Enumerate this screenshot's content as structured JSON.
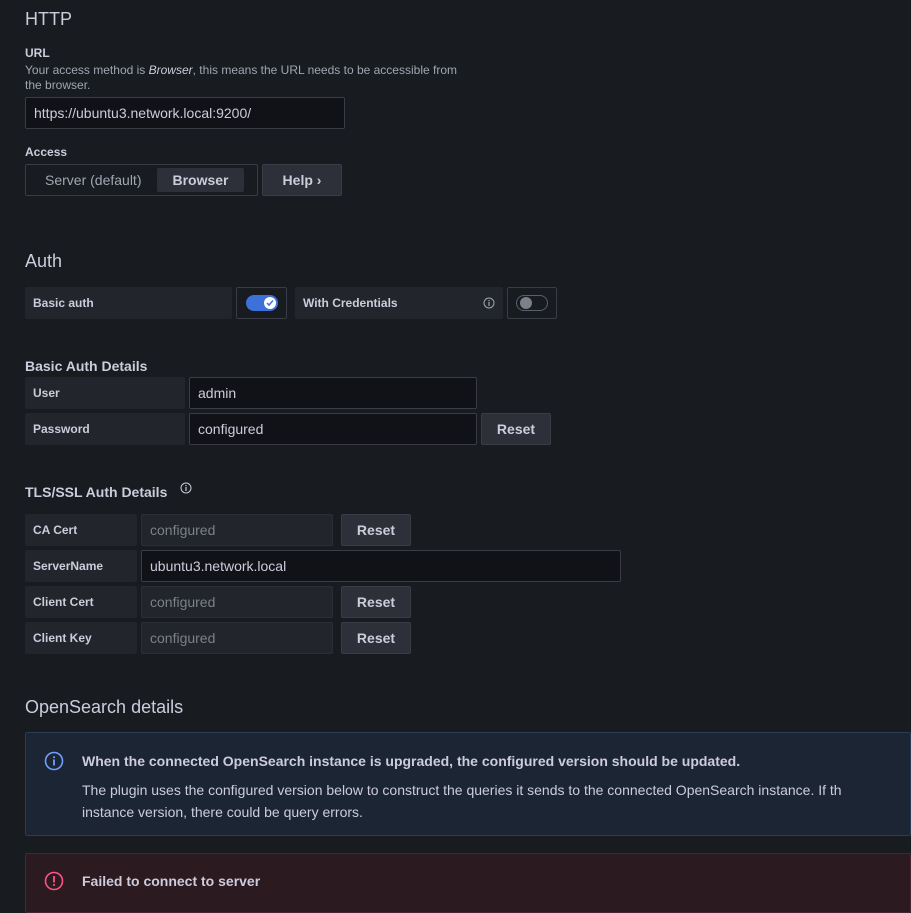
{
  "http": {
    "title": "HTTP",
    "url_label": "URL",
    "url_desc_prefix": "Your access method is ",
    "url_desc_em": "Browser",
    "url_desc_suffix": ", this means the URL needs to be accessible from",
    "url_desc_line2": "the browser.",
    "url_value": "https://ubuntu3.network.local:9200/",
    "access_label": "Access",
    "access_options": [
      "Server (default)",
      "Browser"
    ],
    "access_selected": "Browser",
    "help_label": "Help",
    "help_chevron": "›"
  },
  "auth": {
    "title": "Auth",
    "basic_auth_label": "Basic auth",
    "basic_auth_on": true,
    "with_credentials_label": "With Credentials",
    "with_credentials_on": false
  },
  "basic_auth_details": {
    "title": "Basic Auth Details",
    "user_label": "User",
    "user_value": "admin",
    "password_label": "Password",
    "password_value": "configured",
    "reset_label": "Reset"
  },
  "tls": {
    "title": "TLS/SSL Auth Details",
    "ca_cert_label": "CA Cert",
    "ca_cert_value": "configured",
    "server_name_label": "ServerName",
    "server_name_value": "ubuntu3.network.local",
    "client_cert_label": "Client Cert",
    "client_cert_value": "configured",
    "client_key_label": "Client Key",
    "client_key_value": "configured",
    "reset_label": "Reset"
  },
  "opensearch": {
    "title": "OpenSearch details",
    "info_title": "When the connected OpenSearch instance is upgraded, the configured version should be updated.",
    "info_body_line1": "The plugin uses the configured version below to construct the queries it sends to the connected OpenSearch instance. If th",
    "info_body_line2": "instance version, there could be query errors.",
    "error_text": "Failed to connect to server"
  },
  "colors": {
    "background": "#181b1f",
    "accent": "#3d71d9",
    "info": "#6e9fff",
    "error": "#ff5286"
  }
}
